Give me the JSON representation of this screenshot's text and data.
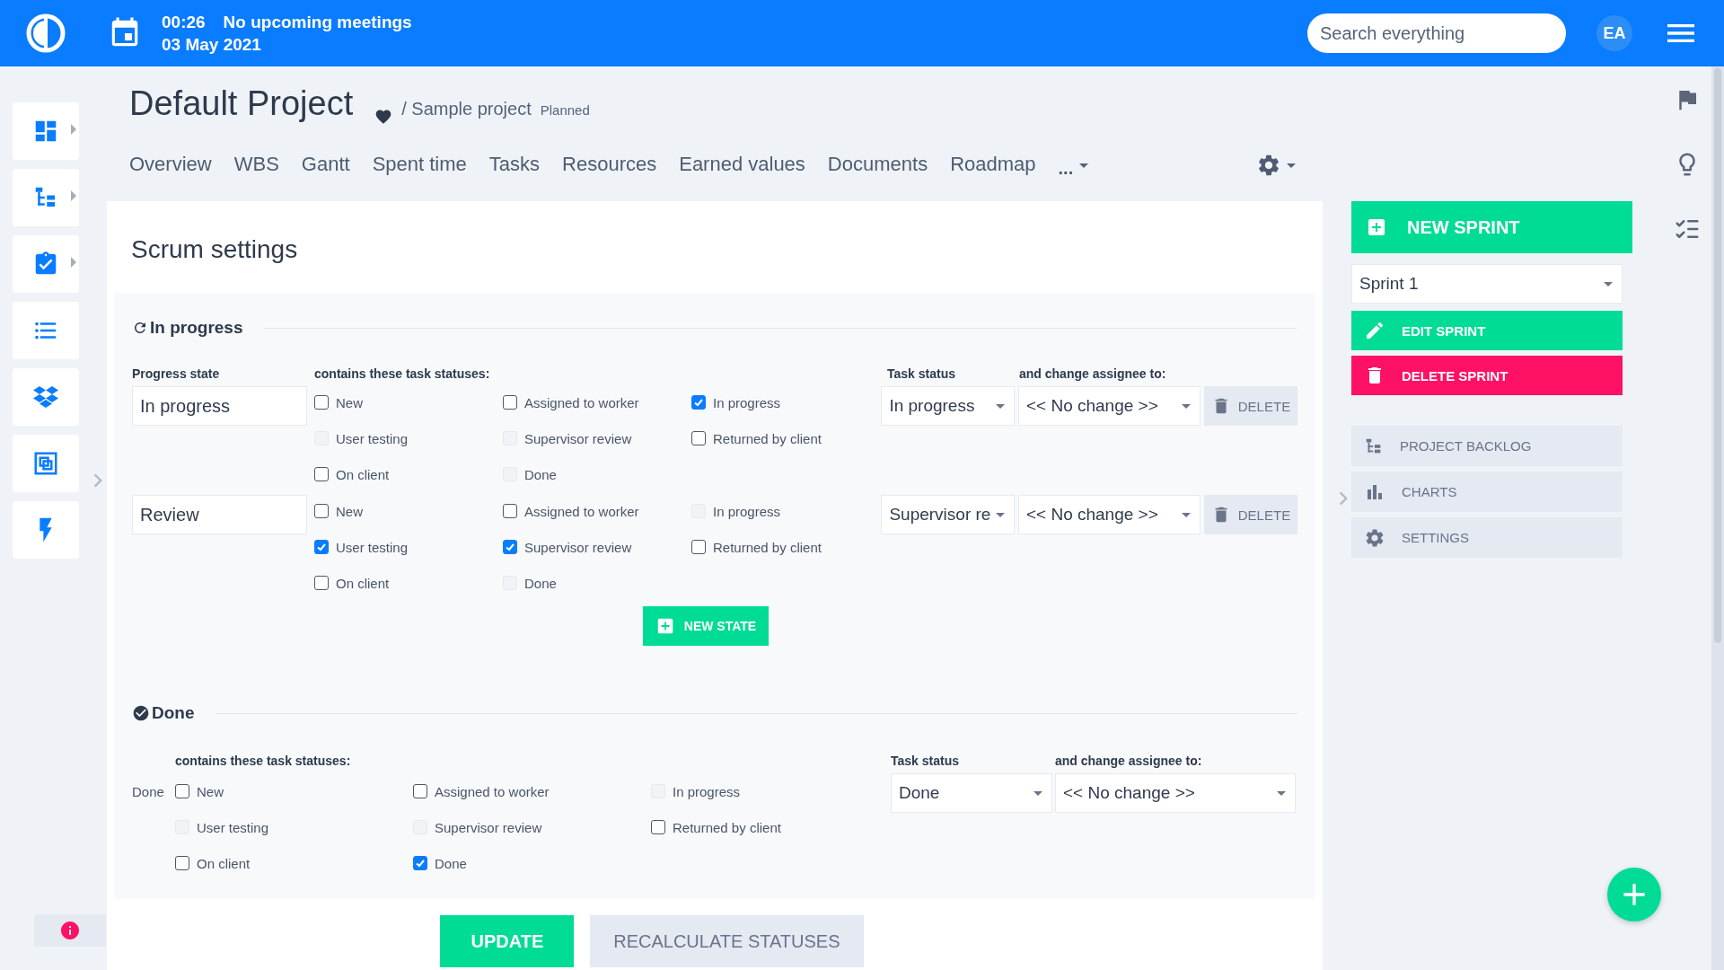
{
  "topbar": {
    "time": "00:26",
    "meetings": "No upcoming meetings",
    "date": "03 May 2021",
    "search": {
      "placeholder": "Search everything"
    },
    "avatar": "EA"
  },
  "sidebar": {
    "items": [
      {
        "expandable": true
      },
      {
        "expandable": true
      },
      {
        "expandable": true
      },
      {
        "expandable": false
      },
      {
        "expandable": false
      },
      {
        "expandable": false
      },
      {
        "expandable": false
      }
    ]
  },
  "project": {
    "title": "Default Project",
    "favorite": true,
    "parent": "/ Sample project",
    "status": "Planned"
  },
  "tabs": [
    {
      "label": "Overview",
      "selected": false
    },
    {
      "label": "WBS",
      "selected": false
    },
    {
      "label": "Gantt",
      "selected": false
    },
    {
      "label": "Spent time",
      "selected": false
    },
    {
      "label": "Tasks",
      "selected": false
    },
    {
      "label": "Resources",
      "selected": false
    },
    {
      "label": "Earned values",
      "selected": false
    },
    {
      "label": "Documents",
      "selected": false
    },
    {
      "label": "Roadmap",
      "selected": false
    },
    {
      "label": "...",
      "selected": false
    }
  ],
  "page_title": "Scrum settings",
  "sections": [
    {
      "kind": "progress",
      "title": "In progress",
      "state_header": "Progress state",
      "statuses_header": "contains these task statuses:",
      "task_status_header": "Task status",
      "assignee_header": "and change assignee to:",
      "new_state": "NEW STATE",
      "states": [
        {
          "name": "In progress",
          "task_status": "In progress",
          "assignee": "<< No change >>",
          "delete": "DELETE",
          "statuses": [
            {
              "label": "New",
              "checked": false,
              "disabled": false
            },
            {
              "label": "Assigned to worker",
              "checked": false,
              "disabled": false
            },
            {
              "label": "In progress",
              "checked": true,
              "disabled": false
            },
            {
              "label": "User testing",
              "checked": false,
              "disabled": true
            },
            {
              "label": "Supervisor review",
              "checked": false,
              "disabled": true
            },
            {
              "label": "Returned by client",
              "checked": false,
              "disabled": false
            },
            {
              "label": "On client",
              "checked": false,
              "disabled": false
            },
            {
              "label": "Done",
              "checked": false,
              "disabled": true
            }
          ]
        },
        {
          "name": "Review",
          "task_status": "Supervisor re",
          "assignee": "<< No change >>",
          "delete": "DELETE",
          "statuses": [
            {
              "label": "New",
              "checked": false,
              "disabled": false
            },
            {
              "label": "Assigned to worker",
              "checked": false,
              "disabled": false
            },
            {
              "label": "In progress",
              "checked": false,
              "disabled": true
            },
            {
              "label": "User testing",
              "checked": true,
              "disabled": false
            },
            {
              "label": "Supervisor review",
              "checked": true,
              "disabled": false
            },
            {
              "label": "Returned by client",
              "checked": false,
              "disabled": false
            },
            {
              "label": "On client",
              "checked": false,
              "disabled": false
            },
            {
              "label": "Done",
              "checked": false,
              "disabled": true
            }
          ]
        }
      ]
    },
    {
      "kind": "done",
      "title": "Done",
      "statuses_header": "contains these task statuses:",
      "task_status_header": "Task status",
      "assignee_header": "and change assignee to:",
      "states": [
        {
          "name": "Done",
          "task_status": "Done",
          "assignee": "<< No change >>",
          "statuses": [
            {
              "label": "New",
              "checked": false,
              "disabled": false
            },
            {
              "label": "Assigned to worker",
              "checked": false,
              "disabled": false
            },
            {
              "label": "In progress",
              "checked": false,
              "disabled": true
            },
            {
              "label": "User testing",
              "checked": false,
              "disabled": true
            },
            {
              "label": "Supervisor review",
              "checked": false,
              "disabled": true
            },
            {
              "label": "Returned by client",
              "checked": false,
              "disabled": false
            },
            {
              "label": "On client",
              "checked": false,
              "disabled": false
            },
            {
              "label": "Done",
              "checked": true,
              "disabled": false
            }
          ]
        }
      ]
    }
  ],
  "actions": {
    "update": "UPDATE",
    "recalculate": "RECALCULATE STATUSES"
  },
  "sprint_panel": {
    "new_sprint": "NEW SPRINT",
    "sprint": "Sprint 1",
    "edit": "EDIT SPRINT",
    "delete": "DELETE SPRINT",
    "links": [
      "PROJECT BACKLOG",
      "CHARTS",
      "SETTINGS"
    ]
  }
}
